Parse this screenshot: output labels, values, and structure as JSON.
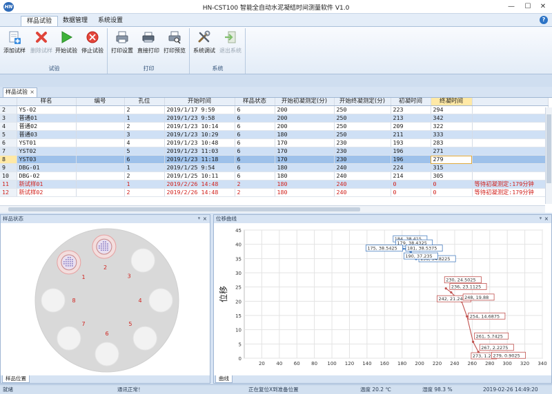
{
  "app": {
    "title": "HN-CST100 智能全自动水泥凝结时间测量软件 V1.0",
    "logo_text": "HN"
  },
  "window_controls": {
    "minimize": "—",
    "maximize": "☐",
    "close": "✕"
  },
  "ribbon": {
    "tabs": [
      {
        "label": "样品试验",
        "active": true
      },
      {
        "label": "数据管理",
        "active": false
      },
      {
        "label": "系统设置",
        "active": false
      }
    ],
    "groups": [
      {
        "label": "试验",
        "buttons": [
          {
            "label": "添加试样",
            "icon": "add-sample-icon",
            "enabled": true
          },
          {
            "label": "删除试样",
            "icon": "delete-sample-icon",
            "enabled": false
          },
          {
            "label": "开始试验",
            "icon": "play-icon",
            "enabled": true
          },
          {
            "label": "停止试验",
            "icon": "stop-icon",
            "enabled": true
          }
        ]
      },
      {
        "label": "打印",
        "buttons": [
          {
            "label": "打印设置",
            "icon": "print-settings-icon",
            "enabled": true
          },
          {
            "label": "直接打印",
            "icon": "printer-icon",
            "enabled": true
          },
          {
            "label": "打印预览",
            "icon": "print-preview-icon",
            "enabled": true
          }
        ]
      },
      {
        "label": "系统",
        "buttons": [
          {
            "label": "系统调试",
            "icon": "tools-icon",
            "enabled": true
          },
          {
            "label": "退出系统",
            "icon": "exit-icon",
            "enabled": false
          }
        ]
      }
    ]
  },
  "doc_tab": {
    "label": "样品试验",
    "close": "×"
  },
  "grid": {
    "columns": [
      "",
      "样名",
      "编号",
      "孔位",
      "开始时间",
      "样品状态",
      "开始初凝测定(分)",
      "开始终凝测定(分)",
      "初凝时间",
      "终凝时间",
      ""
    ],
    "rows": [
      [
        "2",
        "YS-02",
        "",
        "2",
        "2019/1/17 9:59",
        "6",
        "200",
        "250",
        "223",
        "294",
        ""
      ],
      [
        "3",
        "普通01",
        "",
        "1",
        "2019/1/23 9:58",
        "6",
        "200",
        "250",
        "213",
        "342",
        ""
      ],
      [
        "4",
        "普通02",
        "",
        "2",
        "2019/1/23 10:14",
        "6",
        "200",
        "250",
        "209",
        "322",
        ""
      ],
      [
        "5",
        "普通03",
        "",
        "3",
        "2019/1/23 10:29",
        "6",
        "180",
        "250",
        "211",
        "333",
        ""
      ],
      [
        "6",
        "YST01",
        "",
        "4",
        "2019/1/23 10:48",
        "6",
        "170",
        "230",
        "193",
        "283",
        ""
      ],
      [
        "7",
        "YST02",
        "",
        "5",
        "2019/1/23 11:03",
        "6",
        "170",
        "230",
        "196",
        "271",
        ""
      ],
      [
        "8",
        "YST03",
        "",
        "6",
        "2019/1/23 11:18",
        "6",
        "170",
        "230",
        "196",
        "279",
        ""
      ],
      [
        "9",
        "DBG-01",
        "",
        "1",
        "2019/1/25 9:54",
        "6",
        "180",
        "240",
        "224",
        "315",
        ""
      ],
      [
        "10",
        "DBG-02",
        "",
        "2",
        "2019/1/25 10:11",
        "6",
        "180",
        "240",
        "214",
        "305",
        ""
      ],
      [
        "11",
        "新试样01",
        "",
        "1",
        "2019/2/26 14:48",
        "2",
        "180",
        "240",
        "0",
        "0",
        "等待初凝测定:179分钟"
      ],
      [
        "12",
        "新试样02",
        "",
        "2",
        "2019/2/26 14:48",
        "2",
        "180",
        "240",
        "0",
        "0",
        "等待初凝测定:179分钟"
      ]
    ]
  },
  "sample_panel": {
    "title": "样品状态",
    "pin": "ᵠ",
    "close": "×",
    "foot_tab": "样品位置",
    "positions": [
      "1",
      "2",
      "3",
      "4",
      "5",
      "6",
      "7",
      "8"
    ]
  },
  "chart_panel": {
    "title": "位移曲线",
    "pin": "ᵠ",
    "close": "×",
    "foot_tab": "曲线"
  },
  "chart_data": {
    "type": "line",
    "title": "",
    "xlabel": "",
    "ylabel": "位移",
    "xlim": [
      0,
      340
    ],
    "ylim": [
      0,
      45
    ],
    "xticks": [
      20,
      40,
      60,
      80,
      100,
      120,
      140,
      160,
      180,
      200,
      220,
      240,
      260,
      280,
      300,
      320,
      340
    ],
    "yticks": [
      0,
      5,
      10,
      15,
      20,
      25,
      30,
      35,
      40,
      45
    ],
    "grid": true,
    "series": [
      {
        "color": "#4a7fc0",
        "x": [
          175,
          176,
          179,
          181,
          184,
          186,
          190,
          196
        ],
        "y": [
          38.5,
          38.54,
          38.48,
          38.45,
          38.415,
          37.95,
          37.235,
          34.822
        ],
        "labels": [
          {
            "text": "184, 38.415",
            "x": 184,
            "y": 38.415
          },
          {
            "text": "179, 38.4325",
            "x": 179,
            "y": 38.4325
          },
          {
            "text": "181, 38.5375",
            "x": 181,
            "y": 38.5375
          },
          {
            "text": "175, 38.5425",
            "x": 175,
            "y": 38.5425
          },
          {
            "text": "196, 34.8225",
            "x": 196,
            "y": 34.8225
          },
          {
            "text": "190, 37.235",
            "x": 190,
            "y": 37.235
          }
        ]
      },
      {
        "color": "#c0504d",
        "x": [
          230,
          236,
          242,
          248,
          254,
          261,
          267,
          273,
          279
        ],
        "y": [
          24.5025,
          23.1125,
          21.245,
          19.88,
          14.6875,
          5.7425,
          2.2275,
          1.2,
          0.9025
        ],
        "labels": [
          {
            "text": "230, 24.5025",
            "x": 230,
            "y": 24.5025
          },
          {
            "text": "236, 23.1125",
            "x": 236,
            "y": 23.1125
          },
          {
            "text": "242, 21.245",
            "x": 242,
            "y": 21.245
          },
          {
            "text": "248, 19.88",
            "x": 248,
            "y": 19.88
          },
          {
            "text": "254, 14.6875",
            "x": 254,
            "y": 14.6875
          },
          {
            "text": "261, 5.7425",
            "x": 261,
            "y": 5.7425
          },
          {
            "text": "267, 2.2275",
            "x": 267,
            "y": 2.2275
          },
          {
            "text": "273, 1.2",
            "x": 273,
            "y": 1.2
          },
          {
            "text": "279, 0.9025",
            "x": 279,
            "y": 0.9025
          }
        ]
      }
    ]
  },
  "statusbar": {
    "ready": "就绪",
    "comm": "通讯正常！",
    "task": "正在复位X到准备位置",
    "temp": "温度 20.2 ℃",
    "humidity": "湿度 98.3 %",
    "datetime": "2019-02-26  14:49:20"
  }
}
